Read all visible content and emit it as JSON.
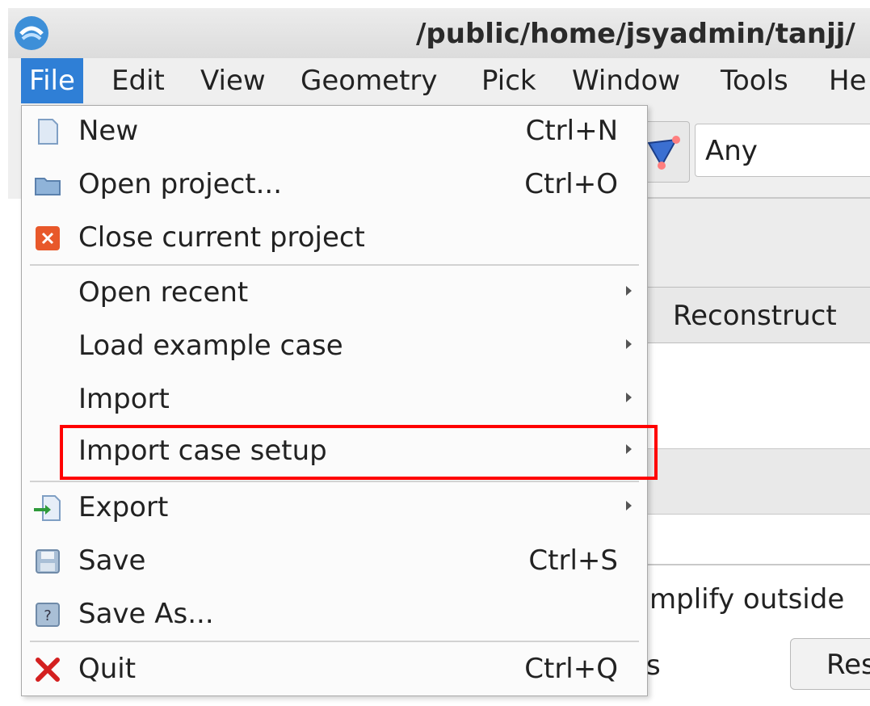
{
  "window": {
    "title": "/public/home/jsyadmin/tanjj/"
  },
  "menubar": {
    "items": [
      {
        "label": "File"
      },
      {
        "label": "Edit"
      },
      {
        "label": "View"
      },
      {
        "label": "Geometry"
      },
      {
        "label": "Pick"
      },
      {
        "label": "Window"
      },
      {
        "label": "Tools"
      },
      {
        "label": "He"
      }
    ]
  },
  "toolbar": {
    "pick_filter_value": "Any"
  },
  "background": {
    "reconstruct_tab": "Reconstruct",
    "simplify_text": "mplify outside",
    "partial_s": "s",
    "reset_button": "Res"
  },
  "file_menu": {
    "items": [
      {
        "label": "New",
        "shortcut": "Ctrl+N",
        "icon": "new-document-icon"
      },
      {
        "label": "Open project...",
        "shortcut": "Ctrl+O",
        "icon": "folder-icon"
      },
      {
        "label": "Close current project",
        "shortcut": "",
        "icon": "close-project-icon"
      },
      {
        "label": "Open recent",
        "submenu": true
      },
      {
        "label": "Load example case",
        "submenu": true
      },
      {
        "label": "Import",
        "submenu": true
      },
      {
        "label": "Import case setup",
        "submenu": true,
        "highlighted": true
      },
      {
        "label": "Export",
        "submenu": true,
        "icon": "export-icon"
      },
      {
        "label": "Save",
        "shortcut": "Ctrl+S",
        "icon": "save-icon"
      },
      {
        "label": "Save As...",
        "shortcut": "",
        "icon": "save-as-icon"
      },
      {
        "label": "Quit",
        "shortcut": "Ctrl+Q",
        "icon": "quit-icon"
      }
    ]
  },
  "colors": {
    "menu_active": "#2f7fd6",
    "highlight_box": "#ff0000"
  }
}
